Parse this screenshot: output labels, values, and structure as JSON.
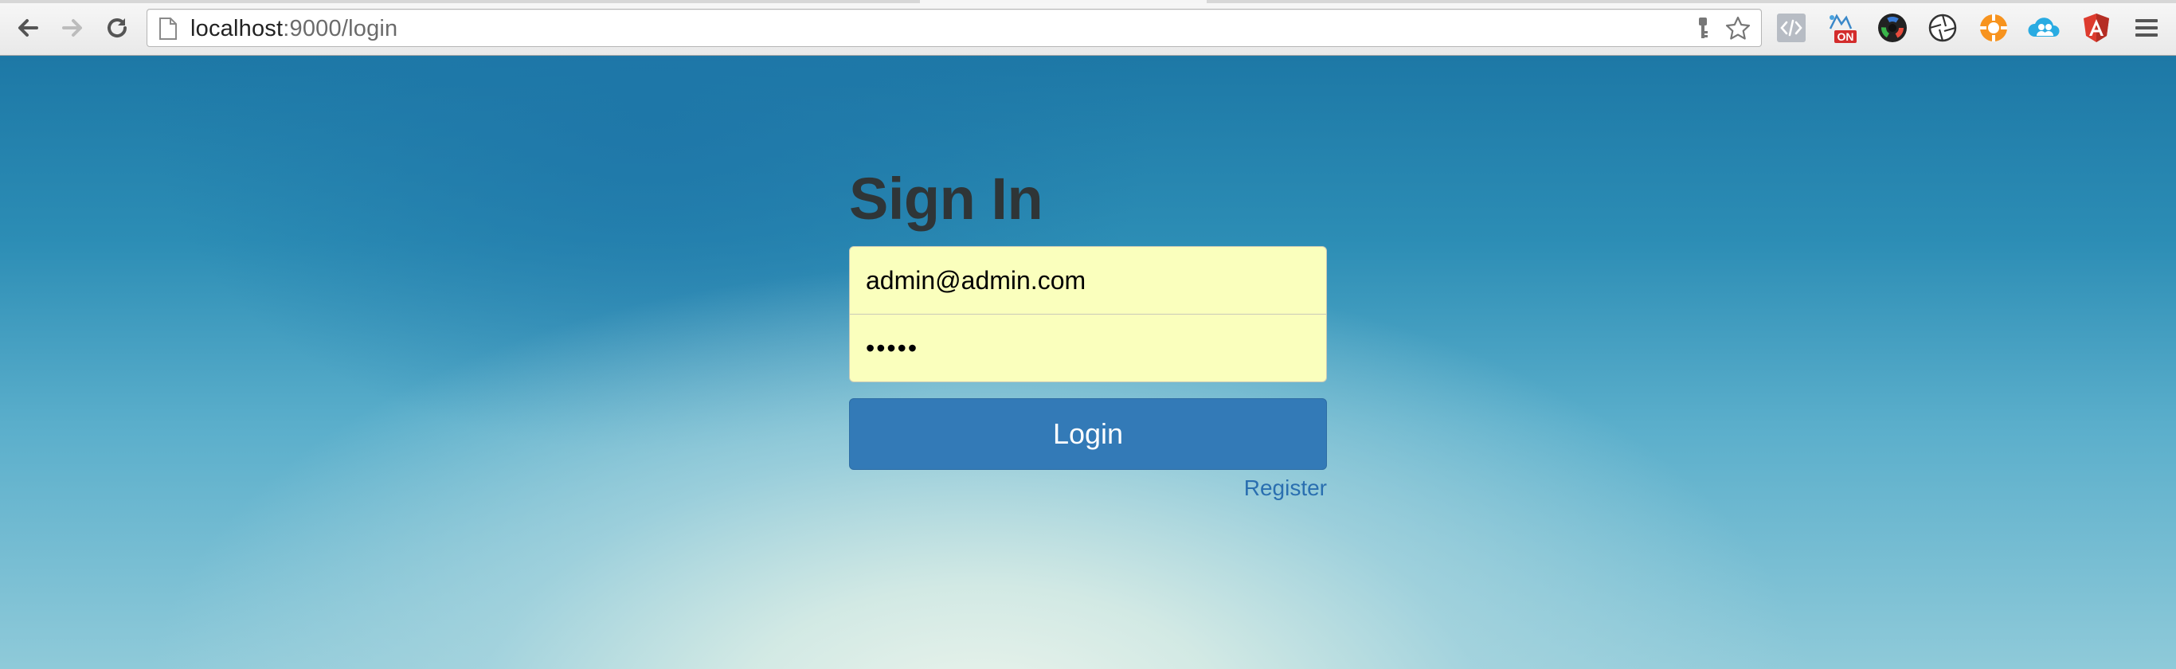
{
  "browser": {
    "url_host": "localhost",
    "url_path": ":9000/login",
    "icons": [
      "back-icon",
      "forward-icon",
      "reload-icon",
      "page-icon",
      "key-icon",
      "star-icon"
    ],
    "extensions": [
      {
        "name": "code-extension-icon"
      },
      {
        "name": "on-badge-extension-icon",
        "badge": "ON"
      },
      {
        "name": "color-wheel-extension-icon"
      },
      {
        "name": "aperture-extension-icon"
      },
      {
        "name": "orange-lifebuoy-extension-icon"
      },
      {
        "name": "people-cloud-extension-icon"
      },
      {
        "name": "angular-extension-icon"
      },
      {
        "name": "menu-icon"
      }
    ]
  },
  "signin": {
    "title": "Sign In",
    "email_value": "admin@admin.com",
    "password_value": "•••••",
    "login_label": "Login",
    "register_label": "Register"
  },
  "colors": {
    "primary_button": "#337ab7",
    "autofill_bg": "#faffbd",
    "link": "#2a6fb0",
    "title": "#2f3537"
  }
}
